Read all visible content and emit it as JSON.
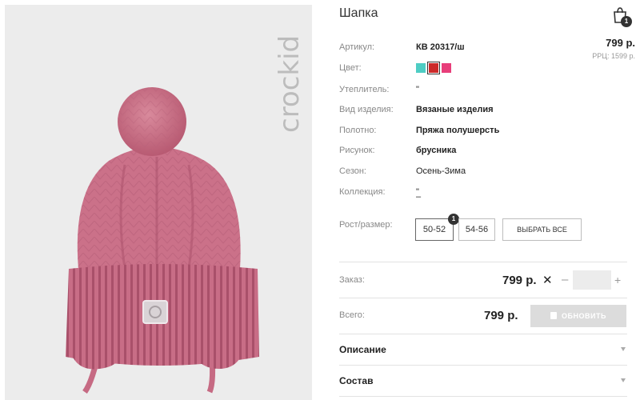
{
  "brand": {
    "logo_text": "crockid"
  },
  "product": {
    "title": "Шапка",
    "price": "799 р.",
    "rrc": "РРЦ: 1599 р."
  },
  "cart": {
    "count": "1"
  },
  "attributes": [
    {
      "label": "Артикул:",
      "value": "КВ 20317/ш"
    },
    {
      "label": "Цвет:",
      "value": ""
    },
    {
      "label": "Утеплитель:",
      "value": "\""
    },
    {
      "label": "Вид изделия:",
      "value": "Вязаные изделия"
    },
    {
      "label": "Полотно:",
      "value": "Пряжа полушерсть"
    },
    {
      "label": "Рисунок:",
      "value": "брусника"
    },
    {
      "label": "Сезон:",
      "value": "Осень-Зима"
    },
    {
      "label": "Коллекция:",
      "value": "\"",
      "value2": "–"
    },
    {
      "label": "Рост/размер:",
      "value": ""
    }
  ],
  "colors": [
    "#4ecdc4",
    "#cc2a2a",
    "#e83e7a"
  ],
  "sizes": {
    "options": [
      "50-52",
      "54-56"
    ],
    "select_all": "ВЫБРАТЬ ВСЕ",
    "badge": "1"
  },
  "order": {
    "label": "Заказ:",
    "price": "799 р.",
    "times": "✕",
    "minus": "–",
    "plus": "+",
    "qty": ""
  },
  "total": {
    "label": "Всего:",
    "price": "799 р.",
    "update_label": "ОБНОВИТЬ"
  },
  "accordions": [
    {
      "title": "Описание"
    },
    {
      "title": "Состав"
    }
  ]
}
